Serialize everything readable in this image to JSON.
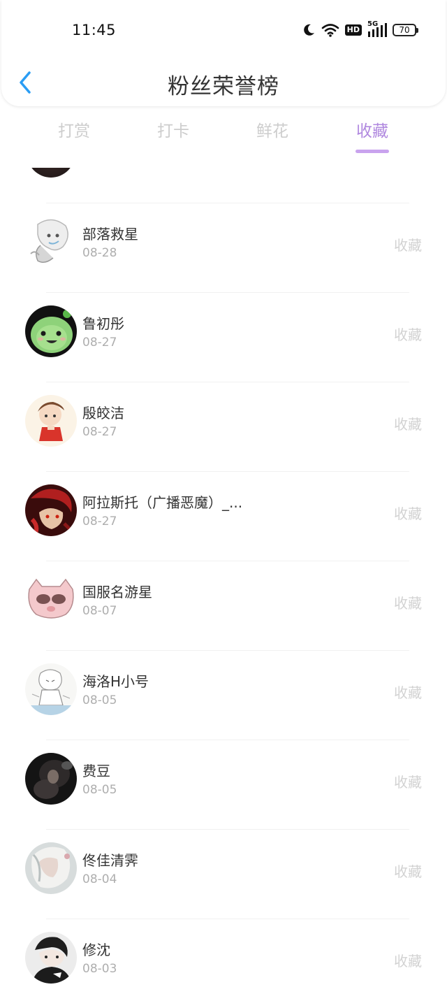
{
  "status_bar": {
    "time": "11:45",
    "icons": [
      "moon-icon",
      "wifi-icon",
      "hd-icon",
      "signal-5g-icon",
      "battery-icon"
    ],
    "hd_label": "HD",
    "network_label": "5G",
    "battery": "70"
  },
  "header": {
    "title": "粉丝荣誉榜",
    "back_icon": "chevron-left-icon",
    "accent": "#2a9df4"
  },
  "tabs": [
    {
      "label": "打赏",
      "active": false
    },
    {
      "label": "打卡",
      "active": false
    },
    {
      "label": "鲜花",
      "active": false
    },
    {
      "label": "收藏",
      "active": true
    }
  ],
  "colors": {
    "tab_active": "#b088df",
    "tab_inactive": "#cdcdcd",
    "underline": "#c9a3ee"
  },
  "rows": [
    {
      "name": "部落救星",
      "date": "08-28",
      "action": "收藏"
    },
    {
      "name": "鲁初彤",
      "date": "08-27",
      "action": "收藏"
    },
    {
      "name": "殷皎洁",
      "date": "08-27",
      "action": "收藏"
    },
    {
      "name": "阿拉斯托（广播恶魔）_...",
      "date": "08-27",
      "action": "收藏"
    },
    {
      "name": "国服名游星",
      "date": "08-07",
      "action": "收藏"
    },
    {
      "name": "海洛H小号",
      "date": "08-05",
      "action": "收藏"
    },
    {
      "name": "费豆",
      "date": "08-05",
      "action": "收藏"
    },
    {
      "name": "佟佳清霁",
      "date": "08-04",
      "action": "收藏"
    },
    {
      "name": "修沈",
      "date": "08-03",
      "action": "收藏"
    }
  ]
}
